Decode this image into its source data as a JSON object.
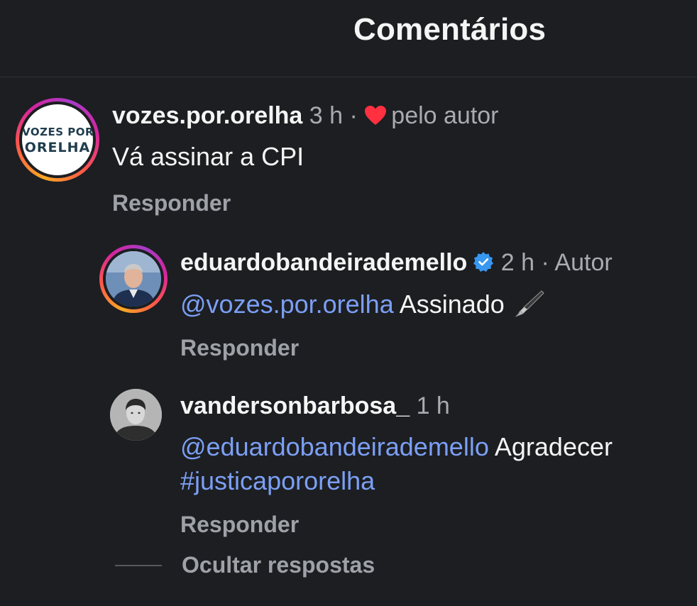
{
  "header": {
    "title": "Comentários"
  },
  "comments": [
    {
      "username": "vozes.por.orelha",
      "time": "3 h",
      "separator": "·",
      "liked_by_author_label": "pelo autor",
      "heart_icon": "heart-icon",
      "text": "Vá assinar a CPI",
      "reply_label": "Responder",
      "avatar_text": [
        "VOZES POR",
        "ORELHA"
      ],
      "avatar_text_color": "#1f3d4d"
    },
    {
      "username": "eduardobandeirademello",
      "verified_icon": "verified-badge-icon",
      "time": "2 h",
      "separator": "·",
      "author_label": "Autor",
      "mention": "@vozes.por.orelha",
      "text": "Assinado",
      "emoji_icon": "fountain-pen-icon",
      "reply_label": "Responder"
    },
    {
      "username": "vandersonbarbosa_",
      "time": "1 h",
      "mention": "@eduardobandeirademello",
      "text": "Agradecer",
      "hashtag": "#justicaporорelha",
      "reply_label": "Responder"
    }
  ],
  "hide_replies_label": "Ocultar respostas",
  "colors": {
    "background": "#1c1e21",
    "mention": "#7c9ff5",
    "meta": "#a8abb0",
    "heart": "#ff3040",
    "verified": "#3897f0"
  }
}
